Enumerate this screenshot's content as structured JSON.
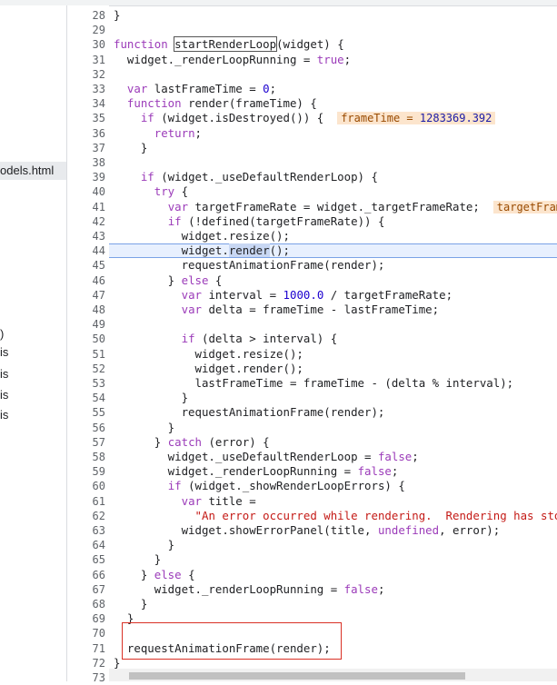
{
  "sidebar": {
    "items": [
      {
        "label": "odels.html",
        "selected": true
      },
      {
        "label": ")",
        "selected": false
      },
      {
        "label": "is",
        "selected": false
      },
      {
        "label": "is",
        "selected": false
      },
      {
        "label": "is",
        "selected": false
      },
      {
        "label": "is",
        "selected": false
      }
    ]
  },
  "editor": {
    "highlighted_line": 44,
    "inline_values": [
      {
        "line": 35,
        "text": "frameTime = 1283369.392"
      },
      {
        "line": 41,
        "text": "targetFram"
      }
    ],
    "lines": [
      {
        "n": "28",
        "text": "}"
      },
      {
        "n": "29",
        "text": ""
      },
      {
        "n": "30",
        "text": "function startRenderLoop(widget) {"
      },
      {
        "n": "31",
        "text": "  widget._renderLoopRunning = true;"
      },
      {
        "n": "32",
        "text": ""
      },
      {
        "n": "33",
        "text": "  var lastFrameTime = 0;"
      },
      {
        "n": "34",
        "text": "  function render(frameTime) {"
      },
      {
        "n": "35",
        "text": "    if (widget.isDestroyed()) {"
      },
      {
        "n": "36",
        "text": "      return;"
      },
      {
        "n": "37",
        "text": "    }"
      },
      {
        "n": "38",
        "text": ""
      },
      {
        "n": "39",
        "text": "    if (widget._useDefaultRenderLoop) {"
      },
      {
        "n": "40",
        "text": "      try {"
      },
      {
        "n": "41",
        "text": "        var targetFrameRate = widget._targetFrameRate;"
      },
      {
        "n": "42",
        "text": "        if (!defined(targetFrameRate)) {"
      },
      {
        "n": "43",
        "text": "          widget.resize();"
      },
      {
        "n": "44",
        "text": "          widget.render();"
      },
      {
        "n": "45",
        "text": "          requestAnimationFrame(render);"
      },
      {
        "n": "46",
        "text": "        } else {"
      },
      {
        "n": "47",
        "text": "          var interval = 1000.0 / targetFrameRate;"
      },
      {
        "n": "48",
        "text": "          var delta = frameTime - lastFrameTime;"
      },
      {
        "n": "49",
        "text": ""
      },
      {
        "n": "50",
        "text": "          if (delta > interval) {"
      },
      {
        "n": "51",
        "text": "            widget.resize();"
      },
      {
        "n": "52",
        "text": "            widget.render();"
      },
      {
        "n": "53",
        "text": "            lastFrameTime = frameTime - (delta % interval);"
      },
      {
        "n": "54",
        "text": "          }"
      },
      {
        "n": "55",
        "text": "          requestAnimationFrame(render);"
      },
      {
        "n": "56",
        "text": "        }"
      },
      {
        "n": "57",
        "text": "      } catch (error) {"
      },
      {
        "n": "58",
        "text": "        widget._useDefaultRenderLoop = false;"
      },
      {
        "n": "59",
        "text": "        widget._renderLoopRunning = false;"
      },
      {
        "n": "60",
        "text": "        if (widget._showRenderLoopErrors) {"
      },
      {
        "n": "61",
        "text": "          var title ="
      },
      {
        "n": "62",
        "text": "            \"An error occurred while rendering.  Rendering has sto"
      },
      {
        "n": "63",
        "text": "          widget.showErrorPanel(title, undefined, error);"
      },
      {
        "n": "64",
        "text": "        }"
      },
      {
        "n": "65",
        "text": "      }"
      },
      {
        "n": "66",
        "text": "    } else {"
      },
      {
        "n": "67",
        "text": "      widget._renderLoopRunning = false;"
      },
      {
        "n": "68",
        "text": "    }"
      },
      {
        "n": "69",
        "text": "  }"
      },
      {
        "n": "70",
        "text": ""
      },
      {
        "n": "71",
        "text": "  requestAnimationFrame(render);"
      },
      {
        "n": "72",
        "text": "}"
      },
      {
        "n": "73",
        "text": ""
      }
    ]
  },
  "colors": {
    "keyword": "#9b3bb9",
    "number": "#1c00cf",
    "string": "#c41a16",
    "highlight_bg": "#e8f0fe",
    "inline_value_bg": "#fce5cd",
    "annotation_border": "#d93025"
  }
}
